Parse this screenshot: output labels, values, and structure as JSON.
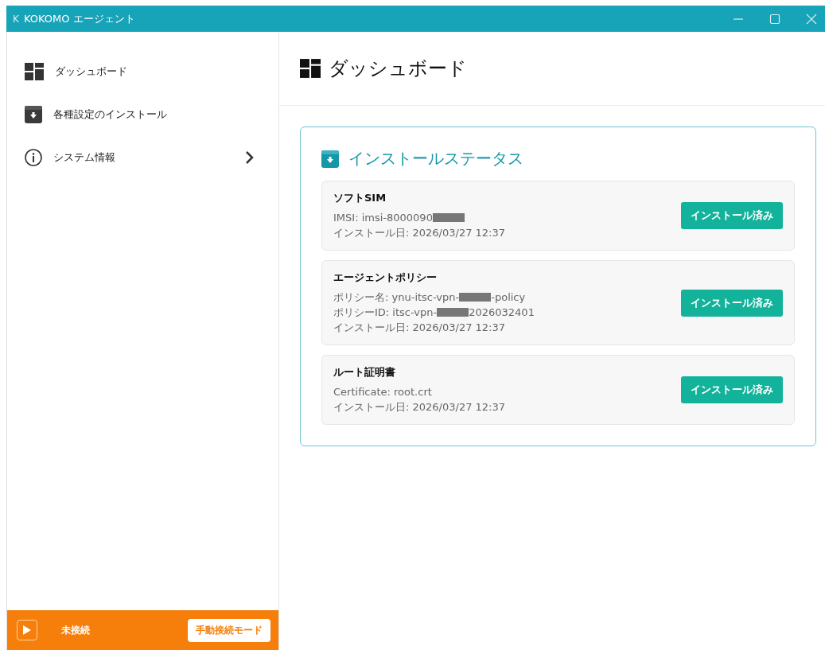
{
  "window": {
    "logo": "K",
    "title": "KOKOMO エージェント"
  },
  "sidebar": {
    "items": [
      {
        "label": "ダッシュボード",
        "kind": "dashboard",
        "has_submenu": false
      },
      {
        "label": "各種設定のインストール",
        "kind": "install",
        "has_submenu": false
      },
      {
        "label": "システム情報",
        "kind": "info",
        "has_submenu": true
      }
    ]
  },
  "connection_bar": {
    "status": "未接続",
    "mode_button": "手動接続モード"
  },
  "page": {
    "title": "ダッシュボード"
  },
  "install_status": {
    "title": "インストールステータス",
    "items": [
      {
        "name": "ソフトSIM",
        "details": [
          [
            {
              "kind": "text",
              "text": "IMSI: imsi-8000090"
            },
            {
              "kind": "redacted"
            }
          ],
          [
            {
              "kind": "text",
              "text": "インストール日: 2026/03/27 12:37"
            }
          ]
        ],
        "status": "インストール済み"
      },
      {
        "name": "エージェントポリシー",
        "details": [
          [
            {
              "kind": "text",
              "text": "ポリシー名: ynu-itsc-vpn-"
            },
            {
              "kind": "redacted"
            },
            {
              "kind": "text",
              "text": "-policy"
            }
          ],
          [
            {
              "kind": "text",
              "text": "ポリシーID: itsc-vpn-"
            },
            {
              "kind": "redacted"
            },
            {
              "kind": "text",
              "text": "2026032401"
            }
          ],
          [
            {
              "kind": "text",
              "text": "インストール日: 2026/03/27 12:37"
            }
          ]
        ],
        "status": "インストール済み"
      },
      {
        "name": "ルート証明書",
        "details": [
          [
            {
              "kind": "text",
              "text": "Certificate: root.crt"
            }
          ],
          [
            {
              "kind": "text",
              "text": "インストール日: 2026/03/27 12:37"
            }
          ]
        ],
        "status": "インストール済み"
      }
    ]
  }
}
